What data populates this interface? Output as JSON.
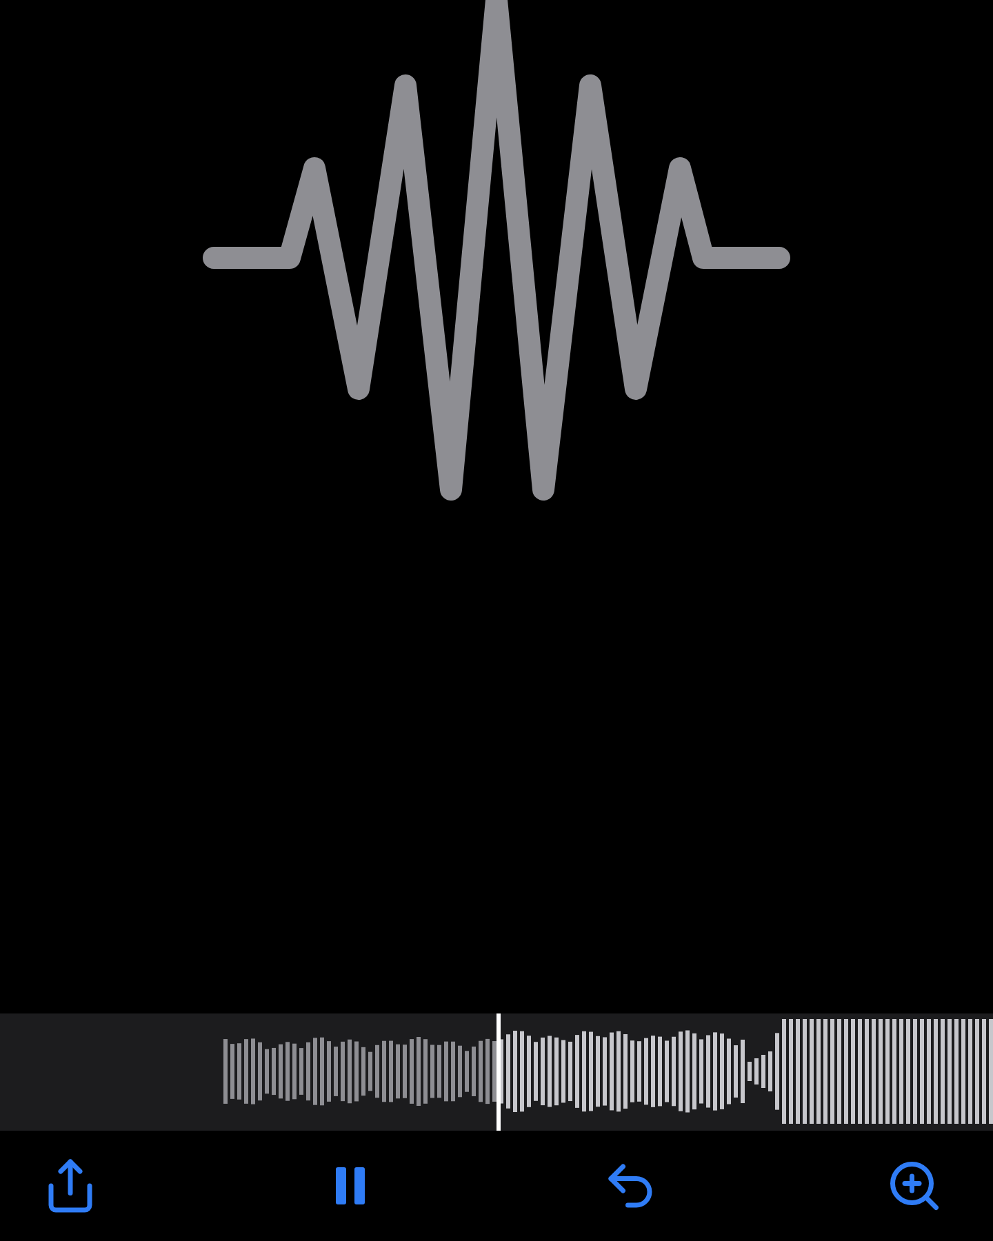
{
  "scrubber": {
    "level": 0.5
  },
  "toolbar": [
    {
      "kind": "share"
    },
    {
      "kind": "pause"
    },
    {
      "kind": "undo"
    },
    {
      "kind": "zoom"
    }
  ]
}
